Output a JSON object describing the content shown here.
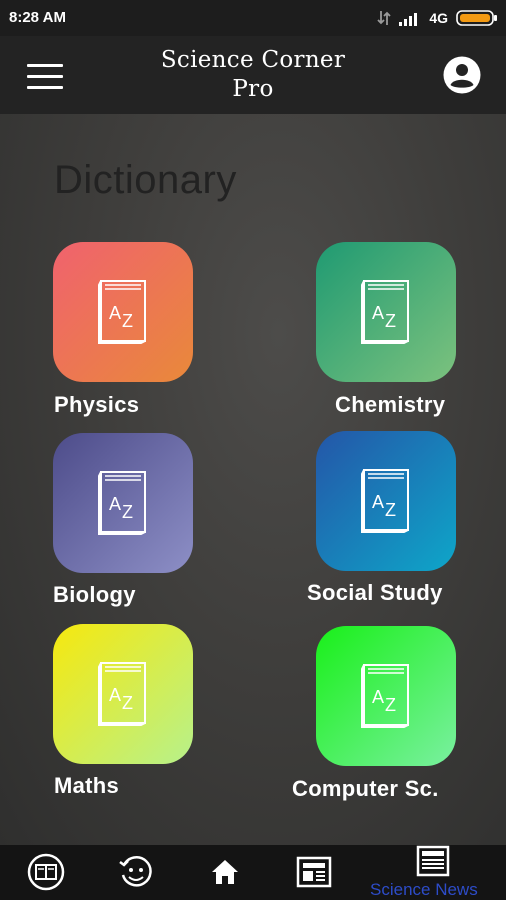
{
  "status_bar": {
    "time": "8:28 AM",
    "network": "4G"
  },
  "app_bar": {
    "title_line1": "Science Corner",
    "title_line2": "Pro"
  },
  "section": {
    "title": "Dictionary"
  },
  "tiles": [
    {
      "label": "Physics",
      "icon": "dictionary-book-icon"
    },
    {
      "label": "Chemistry",
      "icon": "dictionary-book-icon"
    },
    {
      "label": "Biology",
      "icon": "dictionary-book-icon"
    },
    {
      "label": "Social Study",
      "icon": "dictionary-book-icon"
    },
    {
      "label": "Maths",
      "icon": "dictionary-book-icon"
    },
    {
      "label": "Computer Sc.",
      "icon": "dictionary-book-icon"
    }
  ],
  "bottom_nav": {
    "active_label": "Science News",
    "items": [
      "dictionary-icon",
      "quiz-icon",
      "home-icon",
      "newspaper-icon",
      "science-news-icon"
    ]
  },
  "colors": {
    "active_nav": "#2d4cc8",
    "tile_physics": [
      "#f0626e",
      "#e9893a"
    ],
    "tile_chemistry": [
      "#1f9a72",
      "#7cc27e"
    ],
    "tile_biology": [
      "#4d4c8a",
      "#8d8fc6"
    ],
    "tile_social": [
      "#2456a8",
      "#0ea6c9"
    ],
    "tile_maths": [
      "#f6e80e",
      "#b7f18b"
    ],
    "tile_computer": [
      "#19f019",
      "#7af0a0"
    ]
  }
}
